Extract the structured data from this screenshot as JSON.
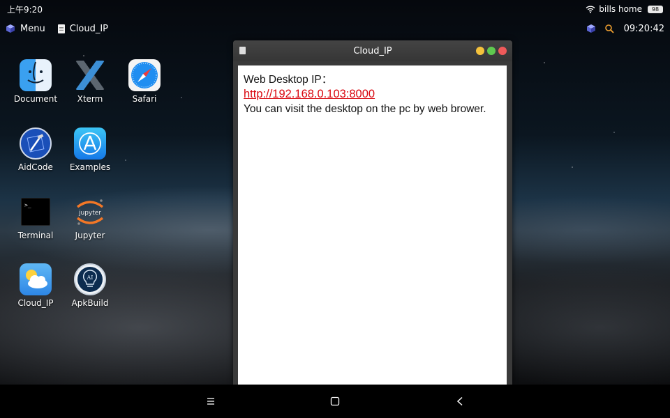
{
  "status_bar": {
    "time": "上午9:20",
    "network_name": "bills home",
    "battery": "98"
  },
  "taskbar": {
    "menu_label": "Menu",
    "open_app_label": "Cloud_IP",
    "clock": "09:20:42"
  },
  "desktop_icons": [
    {
      "label": "Document",
      "icon": "finder-face-icon"
    },
    {
      "label": "Xterm",
      "icon": "xterm-x-icon"
    },
    {
      "label": "Safari",
      "icon": "safari-compass-icon"
    },
    {
      "label": "AidCode",
      "icon": "aidcode-xcode-icon"
    },
    {
      "label": "Examples",
      "icon": "app-store-icon"
    },
    {
      "label": "Terminal",
      "icon": "terminal-icon"
    },
    {
      "label": "Jupyter",
      "icon": "jupyter-icon"
    },
    {
      "label": "Cloud_IP",
      "icon": "weather-cloud-icon"
    },
    {
      "label": "ApkBuild",
      "icon": "ai-bulb-icon"
    }
  ],
  "window": {
    "title": "Cloud_IP",
    "heading": "Web Desktop IP：",
    "link": "http://192.168.0.103:8000 ",
    "message": "You can visit the desktop on the pc by web brower."
  },
  "colors": {
    "link": "#d9070f",
    "close": "#ef5a5a",
    "minimize": "#f4c23c",
    "maximize": "#5fc94f"
  }
}
